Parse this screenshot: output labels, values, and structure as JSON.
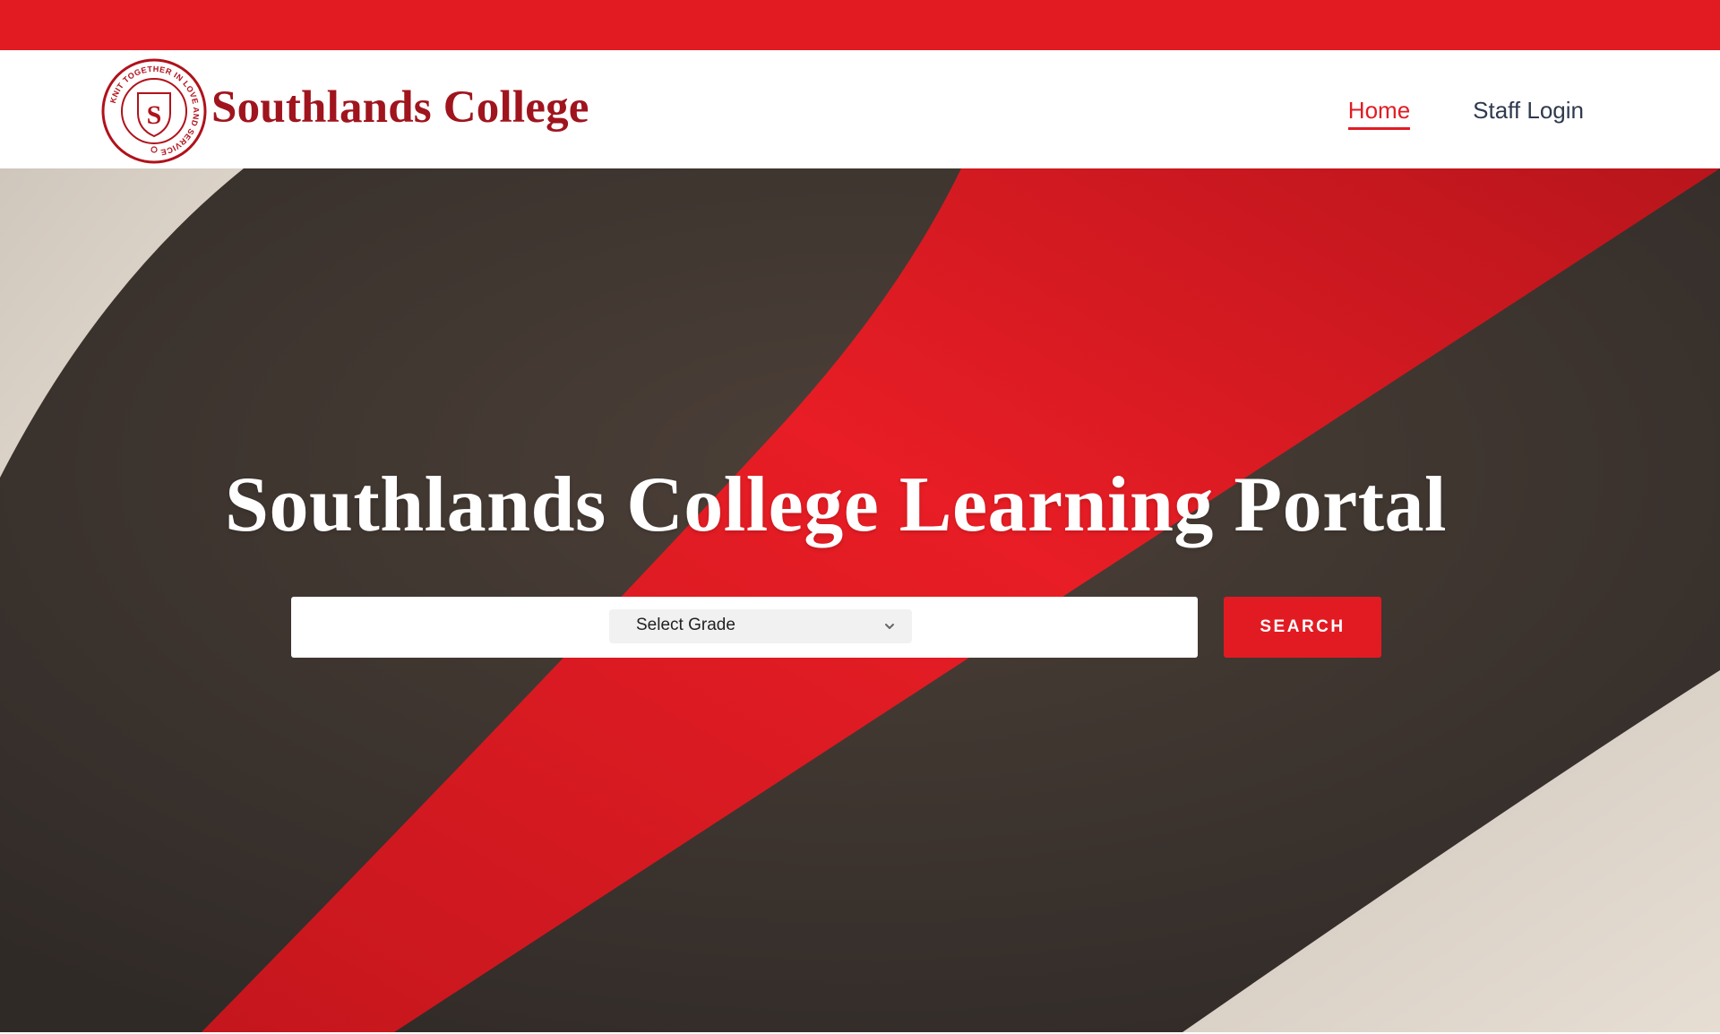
{
  "header": {
    "brand_name": "Southlands College",
    "logo": {
      "letter": "S",
      "motto": "KNIT TOGETHER IN LOVE AND SERVICE"
    },
    "nav": [
      {
        "label": "Home",
        "active": true
      },
      {
        "label": "Staff Login",
        "active": false
      }
    ]
  },
  "hero": {
    "title": "Southlands College Learning Portal",
    "grade_select": {
      "selected": "Select Grade",
      "icon": "chevron-down-icon"
    },
    "search_button": "SEARCH"
  },
  "colors": {
    "accent_red": "#e21b23",
    "brand_dark_red": "#a0141d",
    "hero_dark": "#3d3530",
    "hero_cream": "#d8cec3",
    "nav_text": "#2f3a4e"
  }
}
